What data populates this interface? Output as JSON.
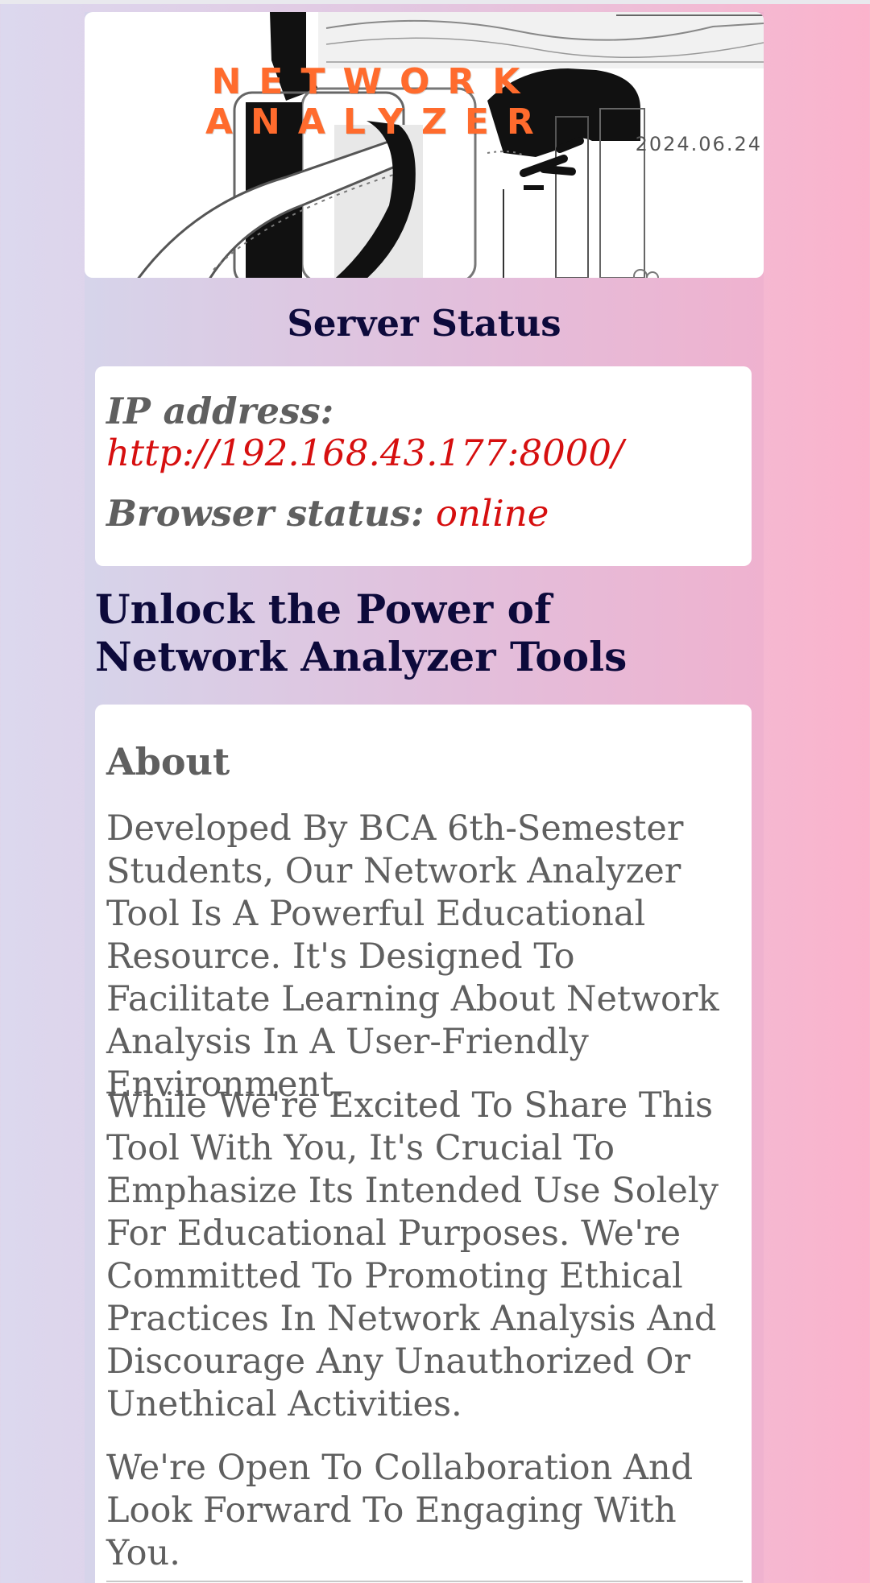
{
  "hero": {
    "title_line1": "NETWORK",
    "title_line2": "ANALYZER",
    "date": "2024.06.24"
  },
  "server_status": {
    "title": "Server Status",
    "ip_label": "IP address:",
    "ip_value": "http://192.168.43.177:8000/",
    "browser_label": "Browser status:",
    "browser_value": "online"
  },
  "headline": "Unlock the Power of Network Analyzer Tools",
  "about": {
    "title": "About",
    "paragraphs": [
      "Developed By BCA 6th-Semester Students, Our Network Analyzer Tool Is A Powerful Educational Resource. It's Designed To Facilitate Learning About Network Analysis In A User-Friendly Environment.",
      "While We're Excited To Share This Tool With You, It's Crucial To Emphasize Its Intended Use Solely For Educational Purposes. We're Committed To Promoting Ethical Practices In Network Analysis And Discourage Any Unauthorized Or Unethical Activities.",
      "We're Open To Collaboration And Look Forward To Engaging With You."
    ]
  },
  "colors": {
    "heading": "#0d0a3b",
    "accent_red": "#d60f0f",
    "title_orange": "#ff6b2d",
    "body_text": "#5f5f5f"
  }
}
